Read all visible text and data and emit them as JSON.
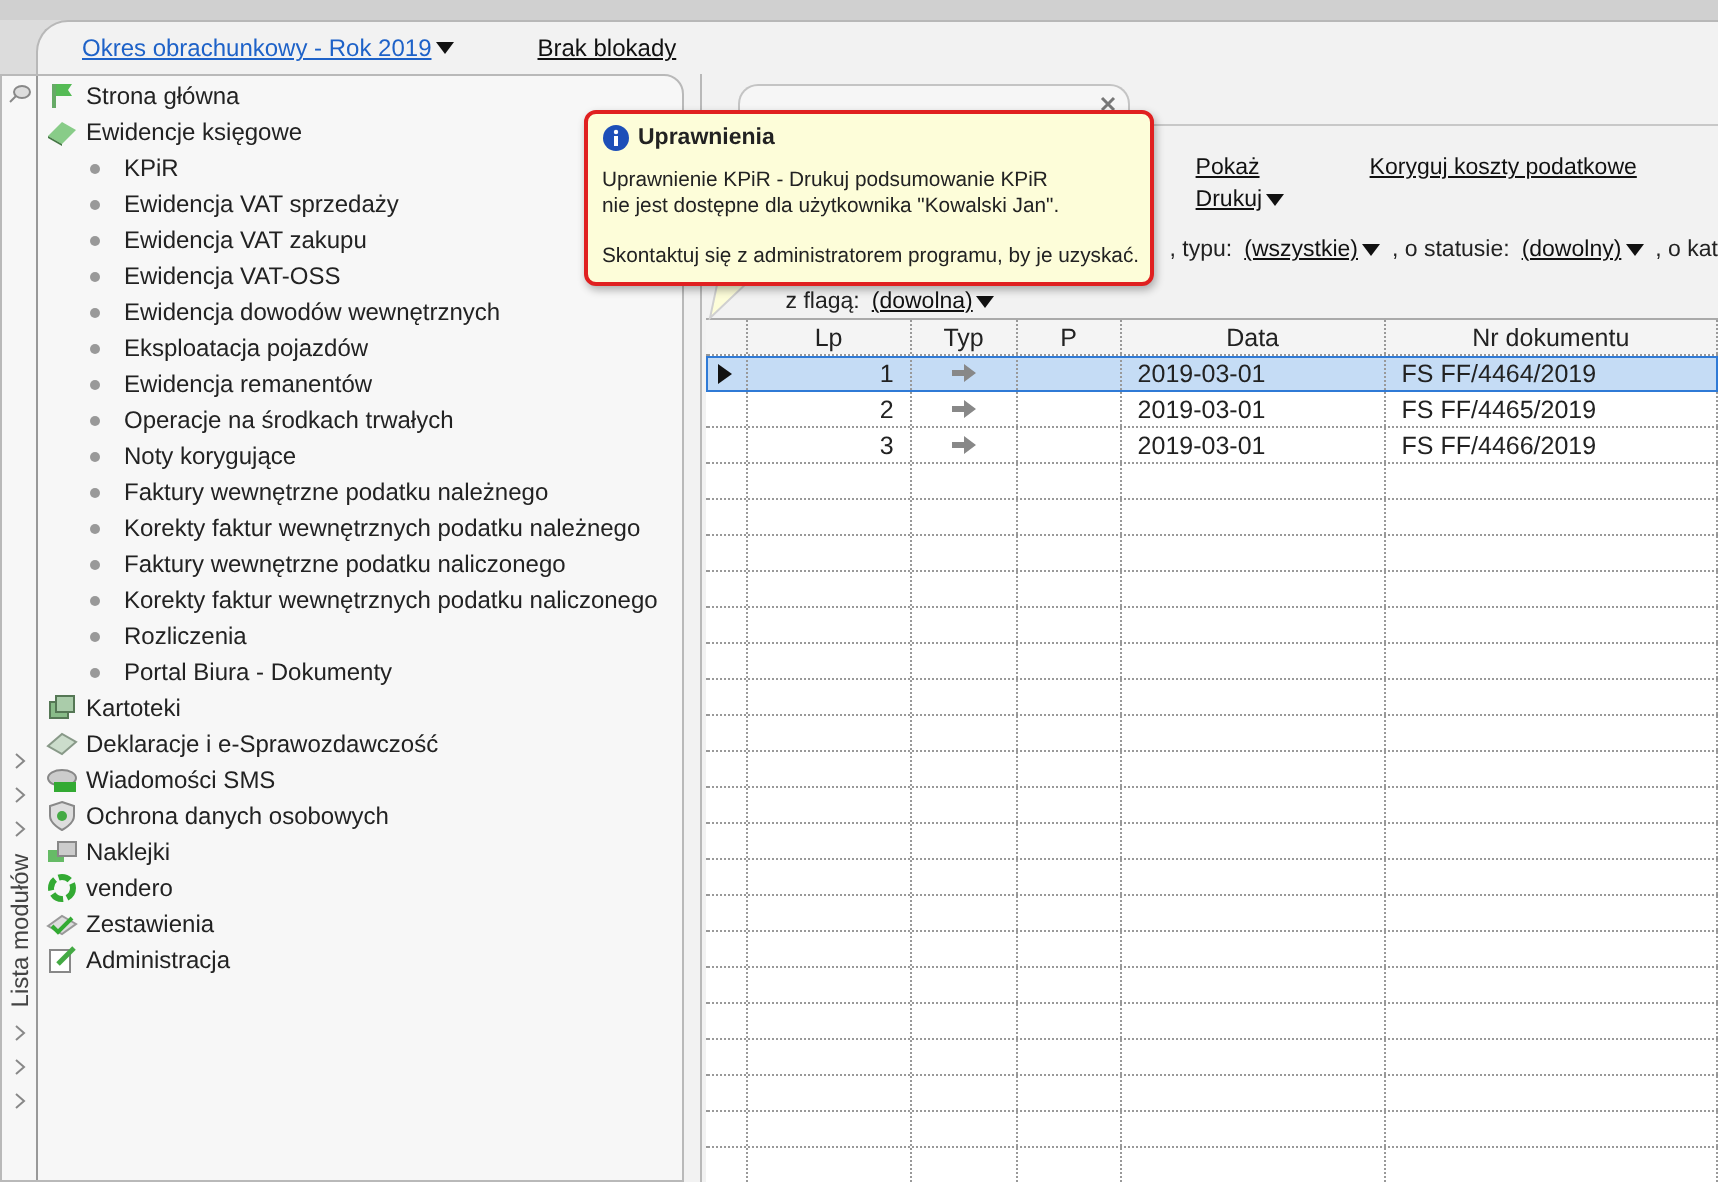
{
  "header": {
    "period_link": "Okres obrachunkowy - Rok 2019",
    "lock_status": "Brak blokady"
  },
  "sidebar": {
    "strip_label": "Lista modułów",
    "items": [
      {
        "label": "Strona główna",
        "kind": "module"
      },
      {
        "label": "Ewidencje księgowe",
        "kind": "module",
        "children": [
          {
            "label": "KPiR"
          },
          {
            "label": "Ewidencja VAT sprzedaży"
          },
          {
            "label": "Ewidencja VAT zakupu"
          },
          {
            "label": "Ewidencja VAT-OSS"
          },
          {
            "label": "Ewidencja dowodów wewnętrznych"
          },
          {
            "label": "Eksploatacja pojazdów"
          },
          {
            "label": "Ewidencja remanentów"
          },
          {
            "label": "Operacje na środkach trwałych"
          },
          {
            "label": "Noty korygujące"
          },
          {
            "label": "Faktury wewnętrzne podatku należnego"
          },
          {
            "label": "Korekty faktur wewnętrznych podatku należnego"
          },
          {
            "label": "Faktury wewnętrzne podatku naliczonego"
          },
          {
            "label": "Korekty faktur wewnętrznych podatku naliczonego"
          },
          {
            "label": "Rozliczenia"
          },
          {
            "label": "Portal Biura - Dokumenty"
          }
        ]
      },
      {
        "label": "Kartoteki",
        "kind": "module"
      },
      {
        "label": "Deklaracje i e-Sprawozdawczość",
        "kind": "module"
      },
      {
        "label": "Wiadomości SMS",
        "kind": "module"
      },
      {
        "label": "Ochrona danych osobowych",
        "kind": "module"
      },
      {
        "label": "Naklejki",
        "kind": "module"
      },
      {
        "label": "vendero",
        "kind": "module"
      },
      {
        "label": "Zestawienia",
        "kind": "module"
      },
      {
        "label": "Administracja",
        "kind": "module"
      }
    ]
  },
  "toolbar": {
    "show_link": "Pokaż",
    "correct_link": "Koryguj koszty podatkowe",
    "print_menu": "Drukuj"
  },
  "filters": {
    "type_label": ", typu:",
    "type_value": "(wszystkie)",
    "status_label": ", o statusie:",
    "status_value": "(dowolny)",
    "category_label": ", o kat",
    "flag_label": "z flagą:",
    "flag_value": "(dowolna)"
  },
  "table": {
    "columns": [
      "Lp",
      "Typ",
      "P",
      "Data",
      "Nr dokumentu"
    ],
    "rows": [
      {
        "lp": "1",
        "date": "2019-03-01",
        "number": "FS FF/4464/2019",
        "selected": true
      },
      {
        "lp": "2",
        "date": "2019-03-01",
        "number": "FS FF/4465/2019",
        "selected": false
      },
      {
        "lp": "3",
        "date": "2019-03-01",
        "number": "FS FF/4466/2019",
        "selected": false
      }
    ]
  },
  "tooltip": {
    "title": "Uprawnienia",
    "lines": [
      "Uprawnienie KPiR - Drukuj podsumowanie KPiR",
      "nie jest dostępne dla użytkownika \"Kowalski Jan\"."
    ],
    "note": "Skontaktuj się z administratorem programu, by je uzyskać."
  }
}
